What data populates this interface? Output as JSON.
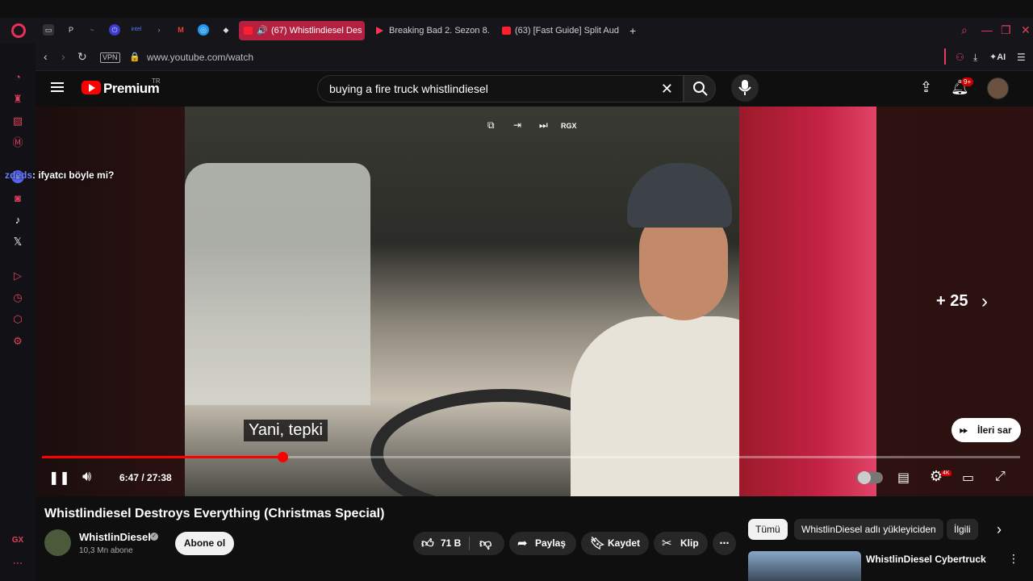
{
  "browser": {
    "tabs": [
      {
        "label": "(67) Whistlindiesel Des",
        "active": true
      },
      {
        "label": "Breaking Bad 2. Sezon 8.",
        "active": false
      },
      {
        "label": "(63) [Fast Guide] Split Aud",
        "active": false
      }
    ],
    "new_tab": "+",
    "url": "www.youtube.com/watch",
    "vpn": "VPN",
    "ai_label": "AI",
    "gx_label": "GX"
  },
  "youtube": {
    "brand": "Premium",
    "region": "TR",
    "search_query": "buying a fire truck whistlindiesel",
    "notification_count": "9+"
  },
  "video": {
    "overlay_rgx": "RGX",
    "chat_user": "zdeds",
    "chat_text": ": ifyatcı böyle mi?",
    "caption": "Yani, tepki",
    "plus_count": "+ 25",
    "skip_label": "İleri sar",
    "time": "6:47 / 27:38",
    "progress": 0.246,
    "hd_badge": "4K"
  },
  "meta": {
    "title": "Whistlindiesel Destroys Everything (Christmas Special)",
    "channel": "WhistlinDiesel",
    "subscribers": "10,3 Mn abone",
    "subscribe_label": "Abone ol",
    "likes": "71 B",
    "share": "Paylaş",
    "save": "Kaydet",
    "clip": "Klip"
  },
  "recommendations": {
    "chips": [
      "Tümü",
      "WhistlinDiesel adlı yükleyiciden",
      "İlgili"
    ],
    "first_title": "WhistlinDiesel Cybertruck"
  }
}
